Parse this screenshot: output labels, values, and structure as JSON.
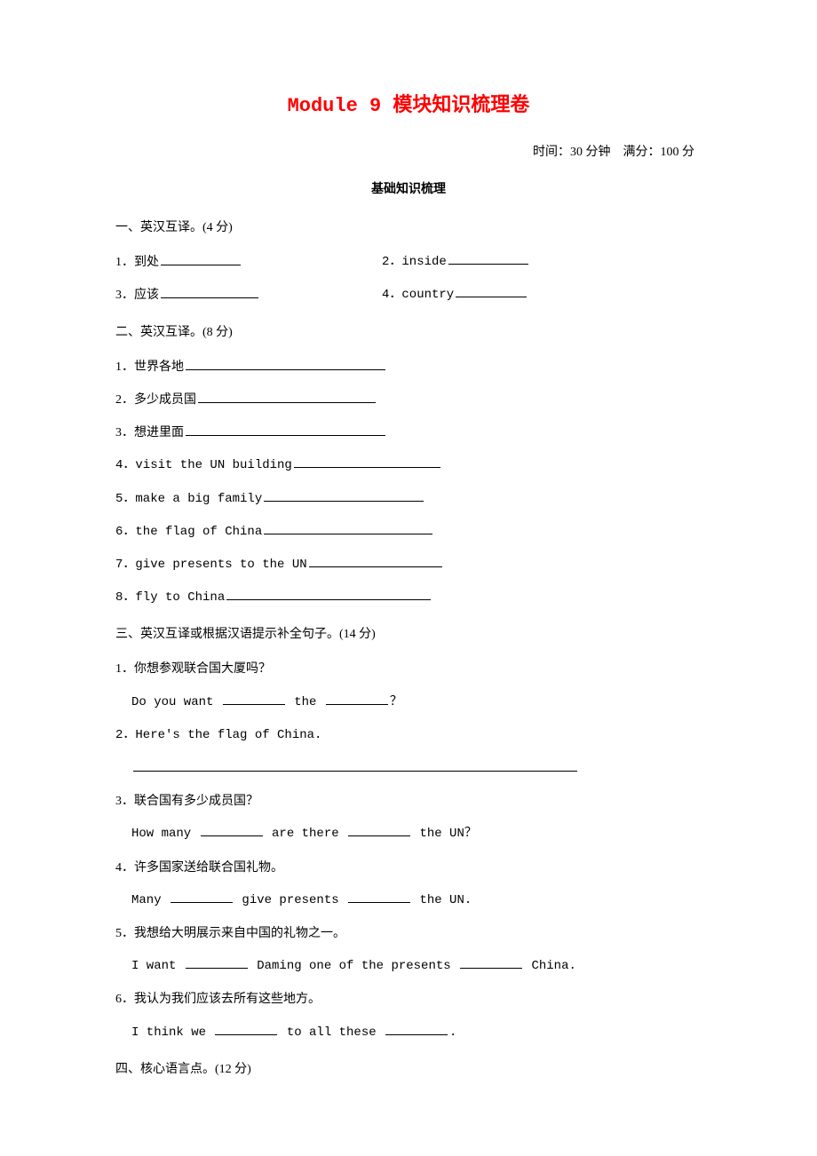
{
  "title": "Module 9 模块知识梳理卷",
  "meta": "时间：30 分钟　满分：100 分",
  "subtitle": "基础知识梳理",
  "s1": {
    "head": "一、英汉互译。(4 分)",
    "q1": "1．到处",
    "q2": "2．inside",
    "q3": "3．应该",
    "q4": "4．country"
  },
  "s2": {
    "head": "二、英汉互译。(8 分)",
    "q1": "1．世界各地",
    "q2": "2．多少成员国",
    "q3": "3．想进里面",
    "q4": "4．visit the UN building",
    "q5": "5．make a big family",
    "q6": "6．the flag of China",
    "q7": "7．give presents to the UN",
    "q8": "8．fly to China"
  },
  "s3": {
    "head": "三、英汉互译或根据汉语提示补全句子。(14 分)",
    "q1": "1．你想参观联合国大厦吗？",
    "a1a": "Do you want ",
    "a1b": " the ",
    "a1c": "？",
    "q2": "2．Here's the flag of China.",
    "q3": "3．联合国有多少成员国？",
    "a3a": "How many ",
    "a3b": " are there ",
    "a3c": "  the UN？",
    "q4": "4．许多国家送给联合国礼物。",
    "a4a": "Many ",
    "a4b": " give presents ",
    "a4c": "  the UN.",
    "q5": "5．我想给大明展示来自中国的礼物之一。",
    "a5a": "I want ",
    "a5b": "  Daming one of the presents ",
    "a5c": " China.",
    "q6": "6．我认为我们应该去所有这些地方。",
    "a6a": "I think we ",
    "a6b": " to all these ",
    "a6c": "."
  },
  "s4": {
    "head": "四、核心语言点。(12 分)"
  }
}
